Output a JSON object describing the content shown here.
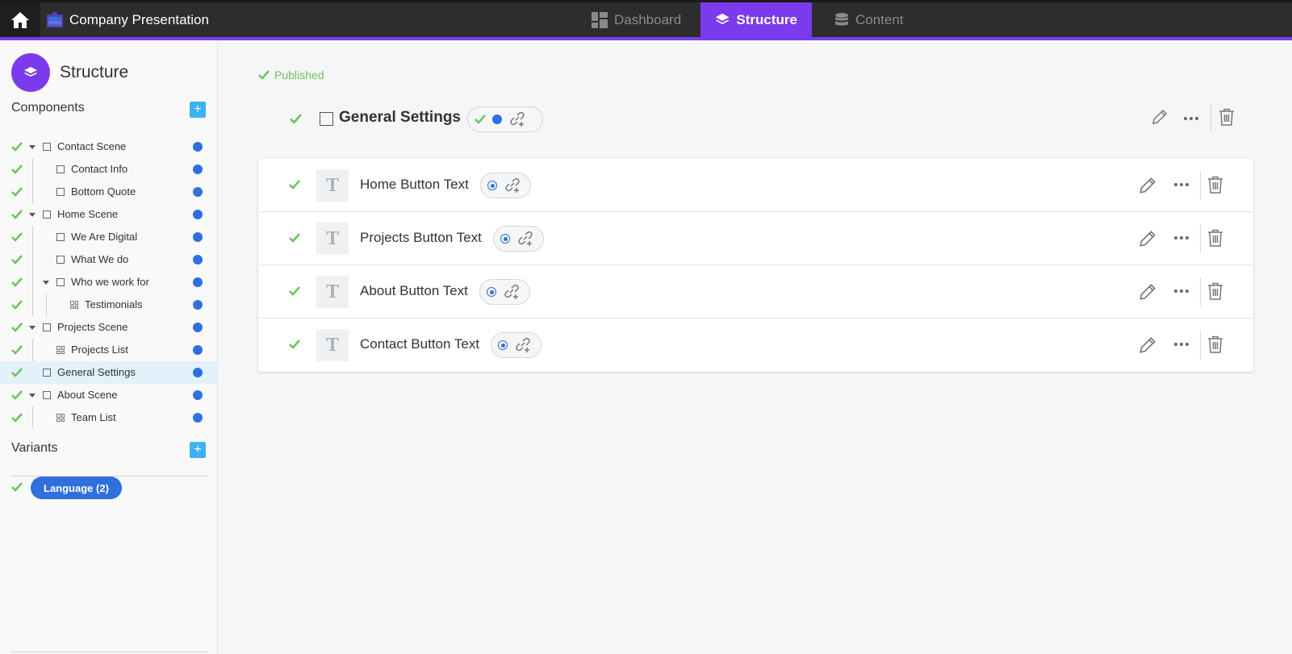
{
  "topbar": {
    "app_title": "Company Presentation",
    "tabs": [
      {
        "label": "Dashboard",
        "icon": "dashboard-icon",
        "active": false
      },
      {
        "label": "Structure",
        "icon": "layers-icon",
        "active": true
      },
      {
        "label": "Content",
        "icon": "database-icon",
        "active": false
      }
    ]
  },
  "colors": {
    "accent": "#7c3aed",
    "check": "#6cc45a",
    "dot": "#2f6fde",
    "add": "#3cb2f5"
  },
  "sidebar": {
    "title": "Structure",
    "components_title": "Components",
    "variants_title": "Variants",
    "items": [
      {
        "label": "Contact Scene",
        "type": "scene",
        "expanded": true,
        "level": 0
      },
      {
        "label": "Contact Info",
        "type": "component",
        "level": 1
      },
      {
        "label": "Bottom Quote",
        "type": "component",
        "level": 1
      },
      {
        "label": "Home Scene",
        "type": "scene",
        "expanded": true,
        "level": 0
      },
      {
        "label": "We Are Digital",
        "type": "component",
        "level": 1
      },
      {
        "label": "What We do",
        "type": "component",
        "level": 1
      },
      {
        "label": "Who we work for",
        "type": "scene",
        "expanded": true,
        "level": 1
      },
      {
        "label": "Testimonials",
        "type": "list",
        "level": 2
      },
      {
        "label": "Projects Scene",
        "type": "scene",
        "expanded": true,
        "level": 0
      },
      {
        "label": "Projects List",
        "type": "list",
        "level": 1
      },
      {
        "label": "General Settings",
        "type": "component",
        "level": 0,
        "selected": true
      },
      {
        "label": "About Scene",
        "type": "scene",
        "expanded": true,
        "level": 0
      },
      {
        "label": "Team List",
        "type": "list",
        "level": 1
      }
    ],
    "variant_pill": "Language (2)"
  },
  "main": {
    "status": "Published",
    "group_title": "General Settings",
    "fields": [
      {
        "name": "Home Button Text"
      },
      {
        "name": "Projects Button Text"
      },
      {
        "name": "About Button Text"
      },
      {
        "name": "Contact Button Text"
      }
    ]
  }
}
